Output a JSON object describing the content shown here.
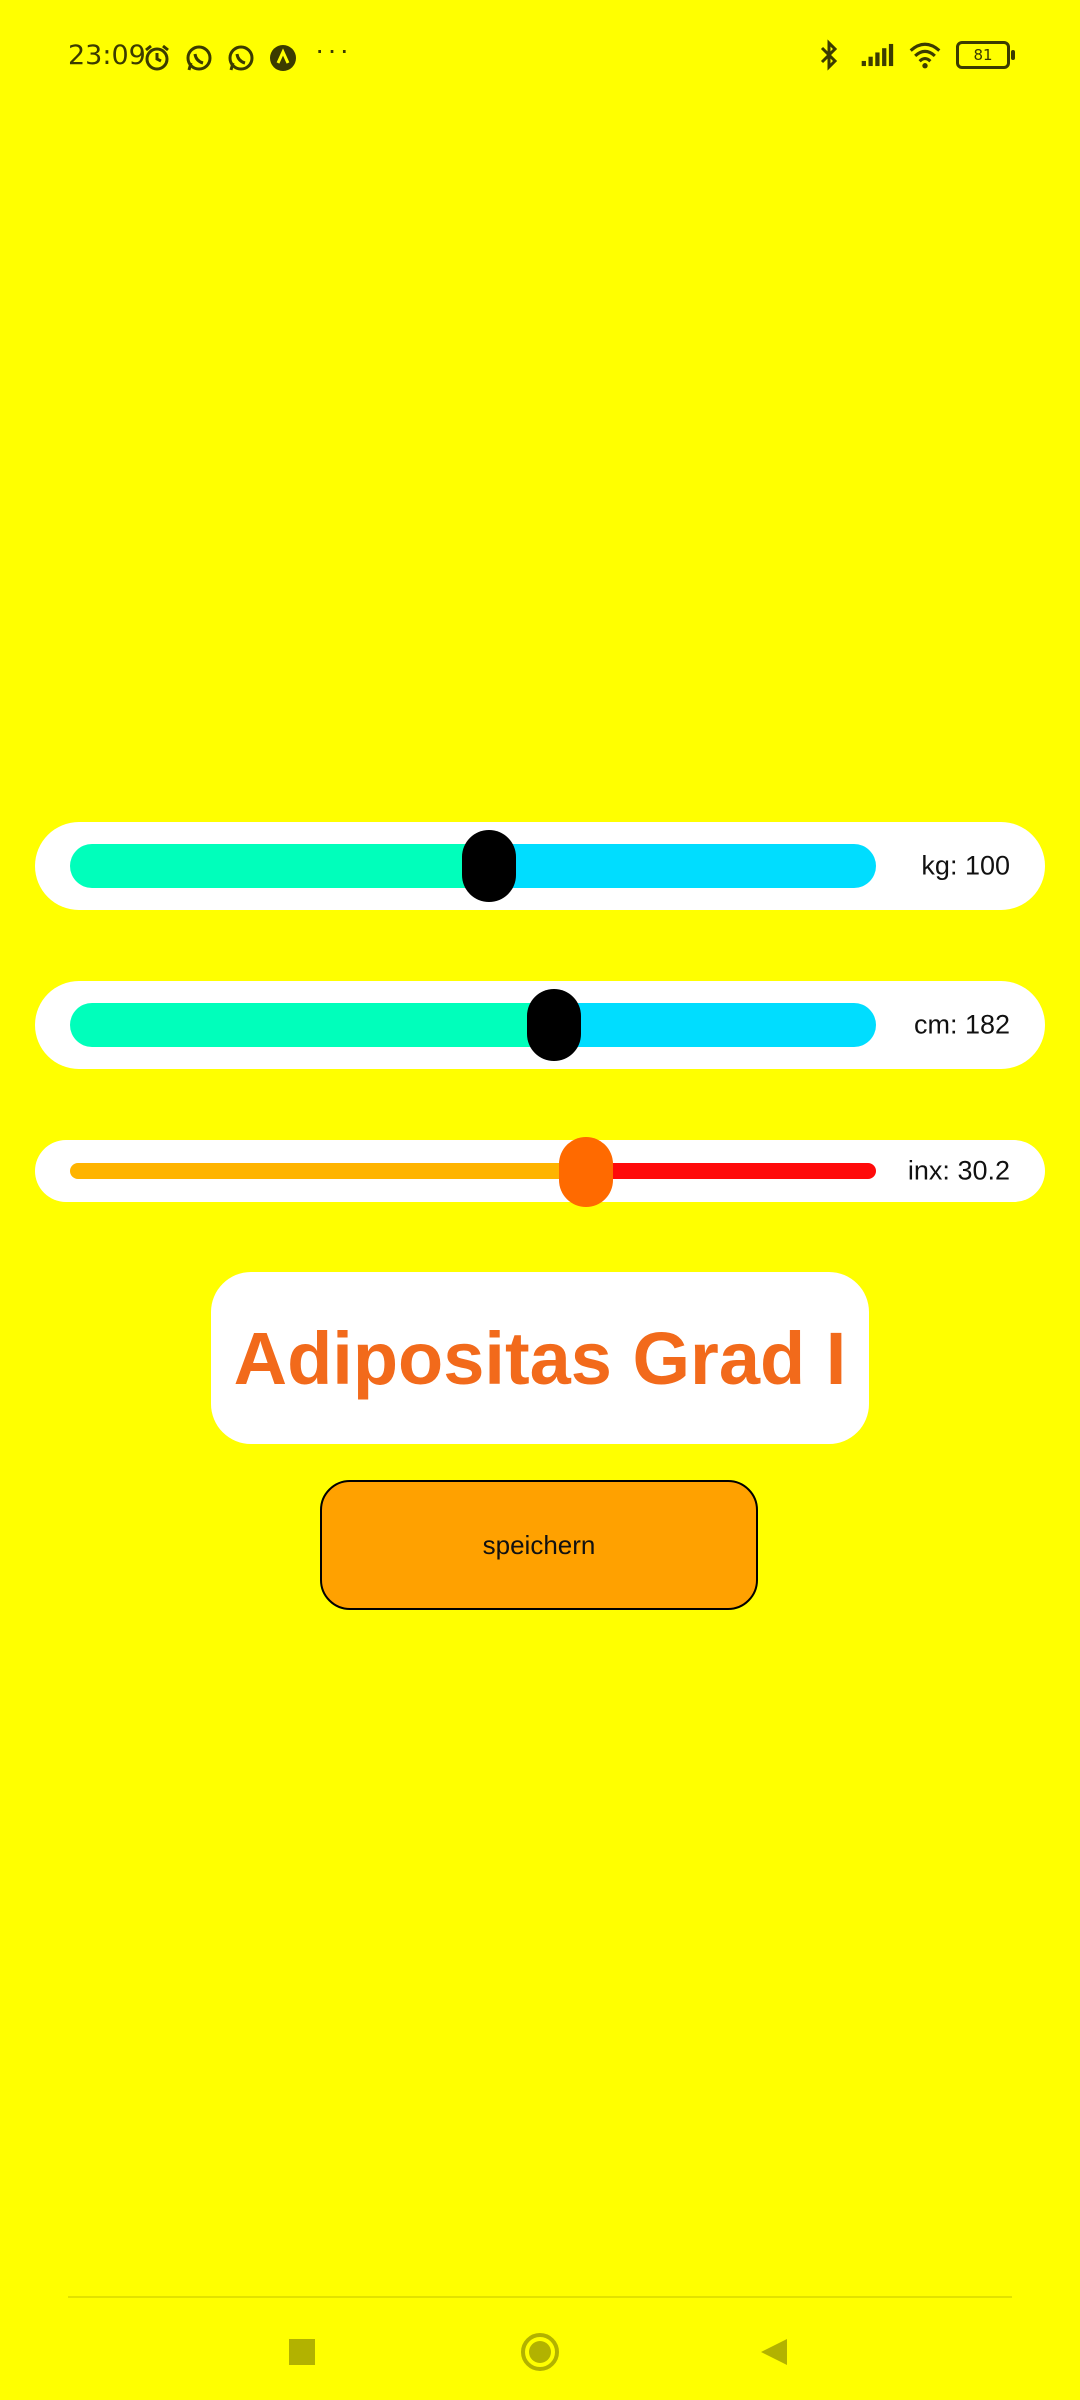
{
  "status_bar": {
    "time": "23:09",
    "left_icons": [
      "alarm-icon",
      "whatsapp-icon",
      "whatsapp-icon",
      "app-icon"
    ],
    "overflow": "···",
    "right_icons": [
      "bluetooth-icon",
      "signal-icon",
      "wifi-icon"
    ],
    "battery": "81"
  },
  "sliders": {
    "kg": {
      "label": "kg: 100",
      "fill_fraction": 0.52,
      "fill_color": "#00FFBB",
      "rest_color": "#00DDFF"
    },
    "cm": {
      "label": "cm: 182",
      "fill_fraction": 0.6,
      "fill_color": "#00FFBB",
      "rest_color": "#00DDFF"
    },
    "inx": {
      "label": "inx: 30.2",
      "fill_fraction": 0.64,
      "fill_color": "#FFB400",
      "rest_color": "#FF0A0A"
    }
  },
  "result": {
    "text": "Adipositas Grad I"
  },
  "actions": {
    "save_label": "speichern"
  },
  "nav": {
    "icons": [
      "recents-square-icon",
      "home-circle-icon",
      "back-triangle-icon"
    ]
  }
}
